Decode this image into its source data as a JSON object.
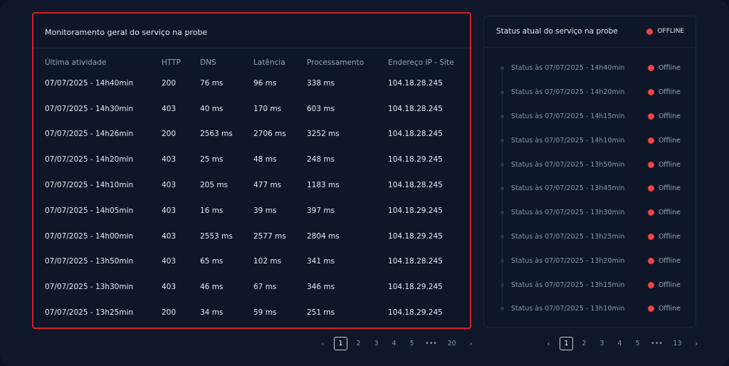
{
  "monitor": {
    "title": "Monitoramento geral do serviço na probe",
    "columns": [
      "Última atividade",
      "HTTP",
      "DNS",
      "Latência",
      "Processamento",
      "Endereço IP - Site"
    ],
    "rows": [
      [
        "07/07/2025 - 14h40min",
        "200",
        "76 ms",
        "96 ms",
        "338 ms",
        "104.18.28.245"
      ],
      [
        "07/07/2025 - 14h30min",
        "403",
        "40 ms",
        "170 ms",
        "603 ms",
        "104.18.28.245"
      ],
      [
        "07/07/2025 - 14h26min",
        "200",
        "2563 ms",
        "2706 ms",
        "3252 ms",
        "104.18.28.245"
      ],
      [
        "07/07/2025 - 14h20min",
        "403",
        "25 ms",
        "48 ms",
        "248 ms",
        "104.18.29.245"
      ],
      [
        "07/07/2025 - 14h10min",
        "403",
        "205 ms",
        "477 ms",
        "1183 ms",
        "104.18.28.245"
      ],
      [
        "07/07/2025 - 14h05min",
        "403",
        "16 ms",
        "39 ms",
        "397 ms",
        "104.18.29.245"
      ],
      [
        "07/07/2025 - 14h00min",
        "403",
        "2553 ms",
        "2577 ms",
        "2804 ms",
        "104.18.29.245"
      ],
      [
        "07/07/2025 - 13h50min",
        "403",
        "65 ms",
        "102 ms",
        "341 ms",
        "104.18.28.245"
      ],
      [
        "07/07/2025 - 13h30min",
        "403",
        "46 ms",
        "67 ms",
        "346 ms",
        "104.18.29.245"
      ],
      [
        "07/07/2025 - 13h25min",
        "200",
        "34 ms",
        "59 ms",
        "251 ms",
        "104.18.29.245"
      ]
    ],
    "pagination": {
      "prev": "‹",
      "next": "›",
      "pages": [
        "1",
        "2",
        "3",
        "4",
        "5",
        "•••",
        "20"
      ],
      "active": "1"
    }
  },
  "status": {
    "title": "Status atual do serviço na probe",
    "current": "OFFLINE",
    "offline_color": "#ef4444",
    "items": [
      {
        "label": "Status às 07/07/2025 - 14h40min",
        "state": "Offline"
      },
      {
        "label": "Status às 07/07/2025 - 14h20min",
        "state": "Offline"
      },
      {
        "label": "Status às 07/07/2025 - 14h15min",
        "state": "Offline"
      },
      {
        "label": "Status às 07/07/2025 - 14h10min",
        "state": "Offline"
      },
      {
        "label": "Status às 07/07/2025 - 13h50min",
        "state": "Offline"
      },
      {
        "label": "Status às 07/07/2025 - 13h45min",
        "state": "Offline"
      },
      {
        "label": "Status às 07/07/2025 - 13h30min",
        "state": "Offline"
      },
      {
        "label": "Status às 07/07/2025 - 13h25min",
        "state": "Offline"
      },
      {
        "label": "Status às 07/07/2025 - 13h20min",
        "state": "Offline"
      },
      {
        "label": "Status às 07/07/2025 - 13h15min",
        "state": "Offline"
      },
      {
        "label": "Status às 07/07/2025 - 13h10min",
        "state": "Offline"
      }
    ],
    "pagination": {
      "prev": "‹",
      "next": "›",
      "pages": [
        "1",
        "2",
        "3",
        "4",
        "5",
        "•••",
        "13"
      ],
      "active": "1"
    }
  }
}
